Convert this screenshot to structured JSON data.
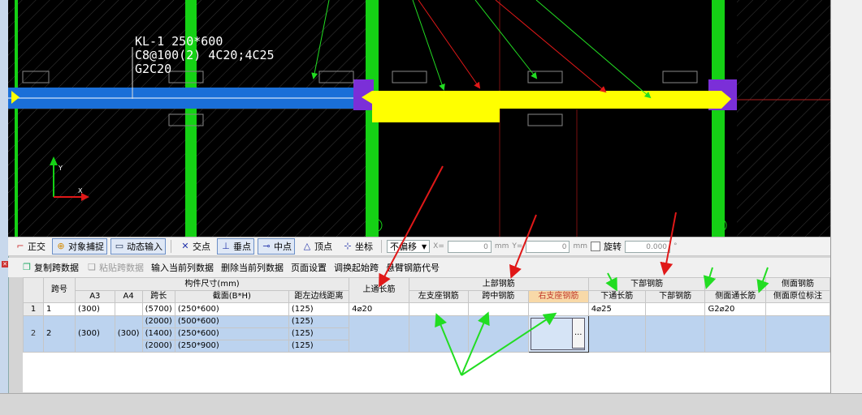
{
  "colors": {
    "canvas_bg": "#000000",
    "column": "#15d115",
    "beam_blue": "#1a6fd8",
    "highlight": "#ffff00",
    "support": "#7b2fd8",
    "arrow_red": "#e01818",
    "arrow_green": "#22dd22"
  },
  "canvas": {
    "beam_label": "KL-1 250*600\nC8@100(2) 4C20;4C25\nG2C20",
    "axis_icon": "axis-icon"
  },
  "snap_toolbar": {
    "ortho": "正交",
    "object_snap": "对象捕捉",
    "dynamic_input": "动态输入",
    "intersection": "交点",
    "perpendicular": "垂点",
    "midpoint": "中点",
    "vertex": "顶点",
    "coordinate": "坐标",
    "offset": "不偏移",
    "x_label": "X=",
    "x_value": "0",
    "y_label": "Y=",
    "y_value": "0",
    "unit": "mm",
    "rotate": "旋转",
    "rotate_value": "0.000",
    "degree": "°"
  },
  "table_toolbar": {
    "copy_span": "复制跨数据",
    "paste_span": "粘贴跨数据",
    "input_column": "输入当前列数据",
    "delete_column": "删除当前列数据",
    "page_setup": "页面设置",
    "swap_start": "调换起始跨",
    "cantilever_code": "悬臂钢筋代号"
  },
  "grid": {
    "headers": {
      "span_no": "跨号",
      "size_group": "构件尺寸(mm)",
      "a3": "A3",
      "a4": "A4",
      "span_len": "跨长",
      "section": "截面(B*H)",
      "dist_left": "距左边线距离",
      "top_through": "上通长筋",
      "top_group": "上部钢筋",
      "left_support": "左支座钢筋",
      "mid_span": "跨中钢筋",
      "right_support": "右支座钢筋",
      "bottom_group": "下部钢筋",
      "bottom_through": "下通长筋",
      "bottom_bar": "下部钢筋",
      "side_through": "侧面通长筋",
      "side_group": "侧面钢筋",
      "side_local": "侧面原位标注"
    },
    "rows": [
      {
        "num": "1",
        "span": "1",
        "a3": "(300)",
        "a4": "",
        "len": "(5700)",
        "section": "(250*600)",
        "dist": "(125)",
        "top": "4⌀20",
        "bottom_through": "4⌀25",
        "side": "G2⌀20"
      },
      {
        "num": "2",
        "span": "2",
        "a3": "(300)",
        "a4": "(300)",
        "subs": [
          {
            "len": "(2000)",
            "section": "(500*600)",
            "dist": "(125)"
          },
          {
            "len": "(1400)",
            "section": "(250*600)",
            "dist": "(125)"
          },
          {
            "len": "(2000)",
            "section": "(250*900)",
            "dist": "(125)"
          }
        ]
      }
    ],
    "edit_button": "..."
  }
}
